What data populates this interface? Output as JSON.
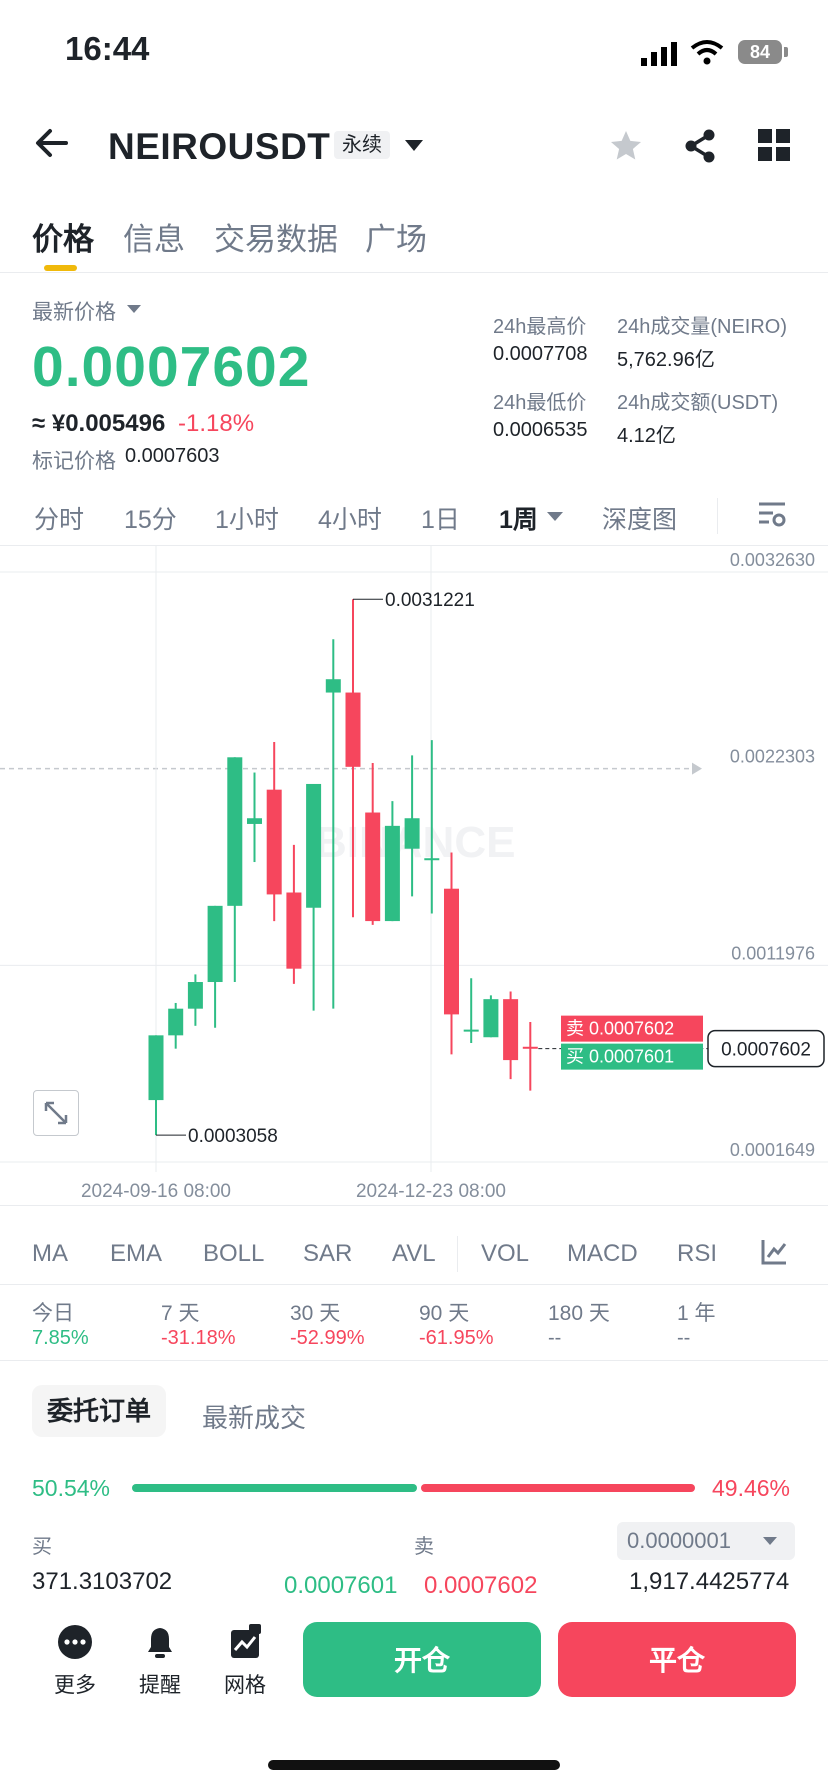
{
  "status_bar": {
    "time": "16:44",
    "battery": "84"
  },
  "header": {
    "pair": "NEIROUSDT",
    "contract_type": "永续"
  },
  "tabs": [
    "价格",
    "信息",
    "交易数据",
    "广场"
  ],
  "price": {
    "latest_label": "最新价格",
    "last": "0.0007602",
    "approx_cny": "≈ ¥0.005496",
    "change": "-1.18%",
    "mark_label": "标记价格",
    "mark_price": "0.0007603"
  },
  "stats": {
    "high_label": "24h最高价",
    "high": "0.0007708",
    "low_label": "24h最低价",
    "low": "0.0006535",
    "vol_label": "24h成交量(NEIRO)",
    "vol": "5,762.96亿",
    "amt_label": "24h成交额(USDT)",
    "amt": "4.12亿"
  },
  "intervals": [
    "分时",
    "15分",
    "1小时",
    "4小时",
    "1日",
    "1周",
    "深度图"
  ],
  "chart_data": {
    "type": "candlestick",
    "interval": "1周",
    "y_ticks": [
      "0.0032630",
      "0.0022303",
      "0.0011976",
      "0.0001649"
    ],
    "ylim": [
      0.0001649,
      0.003263
    ],
    "x_ticks": [
      "2024-09-16 08:00",
      "2024-12-23 08:00"
    ],
    "high_annotation": "0.0031221",
    "low_annotation": "0.0003058",
    "last_price_label": "0.0007602",
    "sell_label": "卖",
    "sell_price": "0.0007602",
    "buy_label": "买",
    "buy_price": "0.0007601",
    "watermark": "BINANCE",
    "candles": [
      {
        "o": 0.00049,
        "h": 0.00074,
        "l": 0.000306,
        "c": 0.00083
      },
      {
        "o": 0.00083,
        "h": 0.001,
        "l": 0.00076,
        "c": 0.00097
      },
      {
        "o": 0.00097,
        "h": 0.00115,
        "l": 0.00088,
        "c": 0.00111
      },
      {
        "o": 0.00111,
        "h": 0.00114,
        "l": 0.00087,
        "c": 0.00151
      },
      {
        "o": 0.00151,
        "h": 0.00192,
        "l": 0.00111,
        "c": 0.00229
      },
      {
        "o": 0.00194,
        "h": 0.00221,
        "l": 0.00174,
        "c": 0.00197
      },
      {
        "o": 0.00212,
        "h": 0.00237,
        "l": 0.00143,
        "c": 0.00157
      },
      {
        "o": 0.00158,
        "h": 0.00183,
        "l": 0.0011,
        "c": 0.00118
      },
      {
        "o": 0.0015,
        "h": 0.002,
        "l": 0.00096,
        "c": 0.00215
      },
      {
        "o": 0.00263,
        "h": 0.00291,
        "l": 0.00097,
        "c": 0.0027
      },
      {
        "o": 0.00263,
        "h": 0.00312,
        "l": 0.00145,
        "c": 0.00224
      },
      {
        "o": 0.002,
        "h": 0.00226,
        "l": 0.00141,
        "c": 0.00143
      },
      {
        "o": 0.00143,
        "h": 0.00206,
        "l": 0.00146,
        "c": 0.00193
      },
      {
        "o": 0.00181,
        "h": 0.0023,
        "l": 0.00156,
        "c": 0.00197
      },
      {
        "o": 0.00176,
        "h": 0.00238,
        "l": 0.00147,
        "c": 0.00176
      },
      {
        "o": 0.0016,
        "h": 0.00179,
        "l": 0.00073,
        "c": 0.00094
      },
      {
        "o": 0.00086,
        "h": 0.00113,
        "l": 0.00079,
        "c": 0.00086
      },
      {
        "o": 0.00082,
        "h": 0.00104,
        "l": 0.00091,
        "c": 0.00102
      },
      {
        "o": 0.00102,
        "h": 0.00106,
        "l": 0.0006,
        "c": 0.0007
      },
      {
        "o": 0.00077,
        "h": 0.0009,
        "l": 0.00054,
        "c": 0.00076
      }
    ]
  },
  "indicators": [
    "MA",
    "EMA",
    "BOLL",
    "SAR",
    "AVL",
    "VOL",
    "MACD",
    "RSI"
  ],
  "periods": [
    {
      "label": "今日",
      "value": "7.85%",
      "color": "#2ebd85"
    },
    {
      "label": "7 天",
      "value": "-31.18%",
      "color": "#f6465d"
    },
    {
      "label": "30 天",
      "value": "-52.99%",
      "color": "#f6465d"
    },
    {
      "label": "90 天",
      "value": "-61.95%",
      "color": "#f6465d"
    },
    {
      "label": "180 天",
      "value": "--",
      "color": "#707a8a"
    },
    {
      "label": "1 年",
      "value": "--",
      "color": "#707a8a"
    }
  ],
  "orders": {
    "tab_active": "委托订单",
    "tab_other": "最新成交",
    "buy_pct": "50.54%",
    "buy_fraction": 0.5054,
    "sell_pct": "49.46%",
    "buy_label": "买",
    "sell_label": "卖",
    "precision": "0.0000001",
    "buy_qty": "371.3103702",
    "bid": "0.0007601",
    "ask": "0.0007602",
    "sell_qty": "1,917.4425774"
  },
  "actions": {
    "more": "更多",
    "alert": "提醒",
    "grid": "网格",
    "open": "开仓",
    "close": "平仓"
  },
  "colors": {
    "up": "#2ebd85",
    "down": "#f6465d",
    "accent": "#f0b90b"
  }
}
